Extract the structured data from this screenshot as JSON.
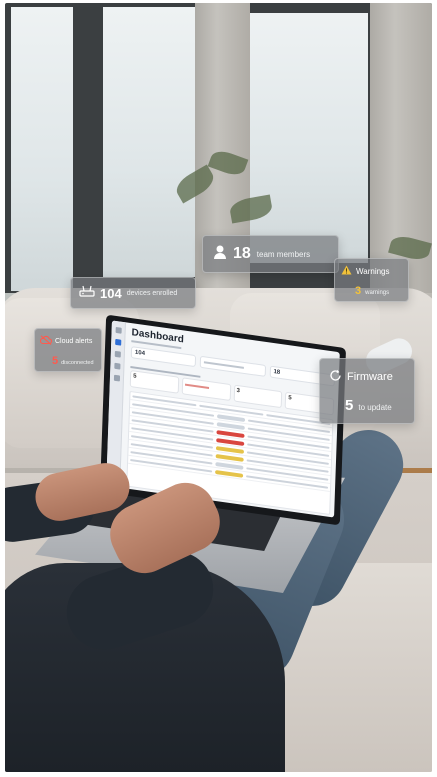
{
  "screen": {
    "title": "Dashboard"
  },
  "overlays": {
    "devices": {
      "count": "104",
      "label": "devices enrolled",
      "icon": "router-icon"
    },
    "members": {
      "count": "18",
      "label": "team members",
      "icon": "person-icon"
    },
    "warnings": {
      "title": "Warnings",
      "count": "3",
      "label": "warnings",
      "icon": "warning-triangle-icon",
      "accent": "#f2c23a"
    },
    "cloud": {
      "title": "Cloud alerts",
      "count": "5",
      "label": "disconnected",
      "icon": "cloud-off-icon",
      "accent": "#ff5a4e"
    },
    "firmware": {
      "title": "Firmware",
      "count": "5",
      "label": "to update",
      "icon": "refresh-icon"
    }
  }
}
